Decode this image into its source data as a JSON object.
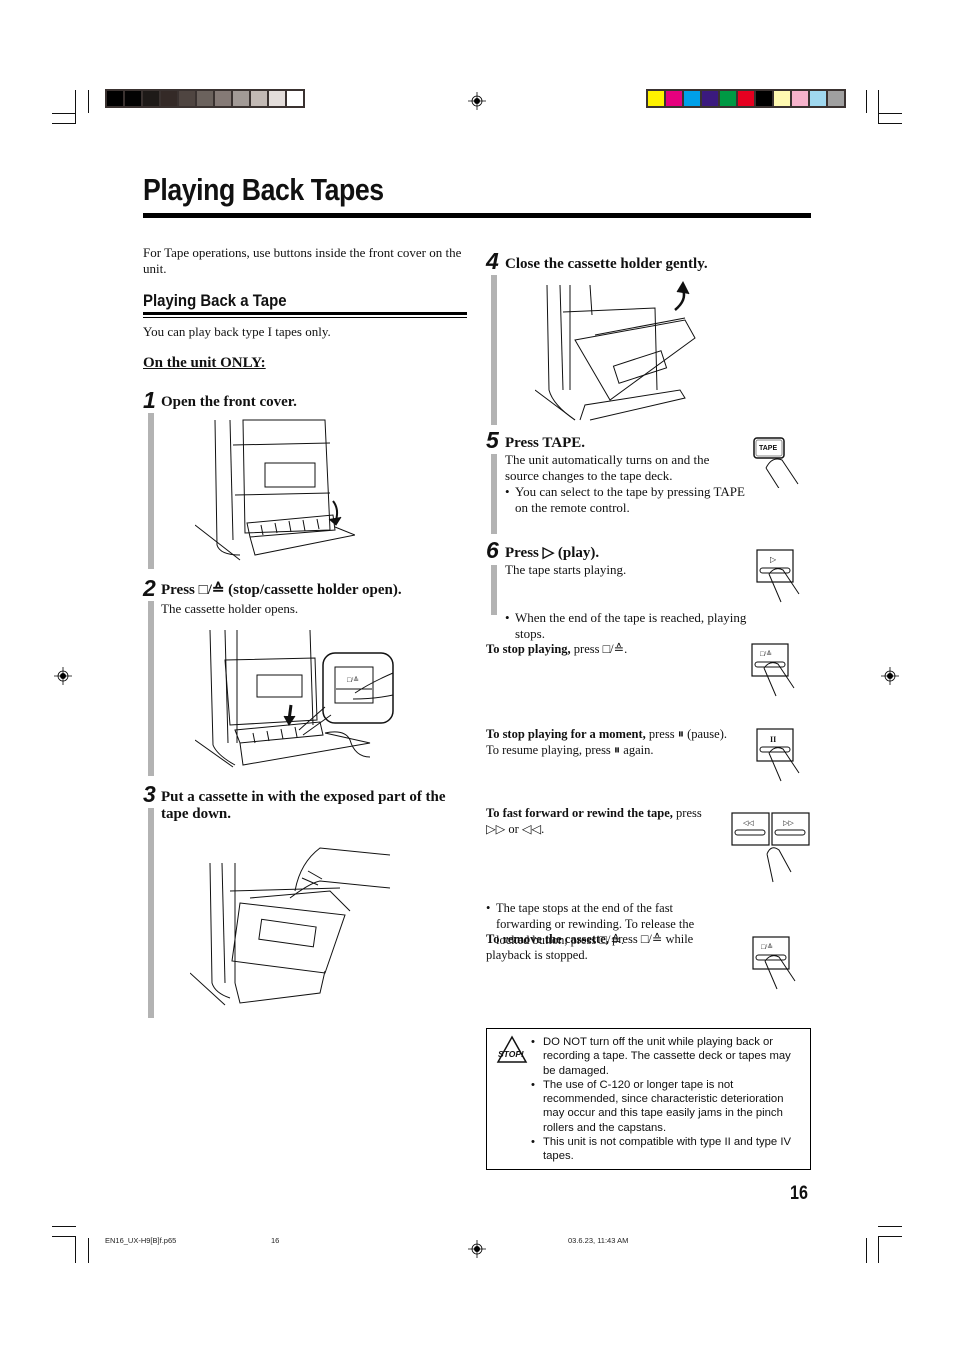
{
  "print_marks": {
    "grayscale_bar": [
      "#000000",
      "#030303",
      "#1e1a18",
      "#342a27",
      "#4f4541",
      "#6b625d",
      "#857a76",
      "#a29a96",
      "#c2b9b4",
      "#e3ddda",
      "#ffffff"
    ],
    "color_bar": [
      "#fff200",
      "#e6007e",
      "#00a0e9",
      "#3b1a7e",
      "#009944",
      "#e60020",
      "#000000",
      "#fff9b1",
      "#f6b3cb",
      "#a0d8ef",
      "#a0a0a0"
    ]
  },
  "header": {
    "title": "Playing Back Tapes"
  },
  "intro": "For Tape operations, use buttons inside the front cover on the unit.",
  "section": {
    "heading": "Playing Back a Tape",
    "note": "You can play back type I tapes only.",
    "subheading": "On the unit ONLY:"
  },
  "steps": [
    {
      "number": "1",
      "heading": "Open the front cover.",
      "body": "",
      "bullets": []
    },
    {
      "number": "2",
      "heading": "Press □/≙ (stop/cassette holder open).",
      "body": "The cassette holder opens.",
      "bullets": []
    },
    {
      "number": "3",
      "heading": "Put a cassette in with the exposed part of the tape down.",
      "body": "",
      "bullets": []
    },
    {
      "number": "4",
      "heading": "Close the cassette holder gently.",
      "body": "",
      "bullets": []
    },
    {
      "number": "5",
      "heading": "Press TAPE.",
      "body": "The unit automatically turns on and the source changes to the tape deck.",
      "bullets": [
        "You can select to the tape by pressing TAPE on the remote control."
      ]
    },
    {
      "number": "6",
      "heading": "Press ▷ (play).",
      "body": "The tape starts playing.",
      "bullets": [
        "When the end of the tape is reached, playing stops."
      ]
    }
  ],
  "operations": [
    {
      "lead": "To stop playing,",
      "text": " press □/≙.",
      "extra": "",
      "bullets": []
    },
    {
      "lead": "To stop playing for a moment,",
      "text": " press ⏸ (pause).",
      "extra": "To resume playing, press ⏸ again.",
      "bullets": []
    },
    {
      "lead": "To fast forward or rewind the tape,",
      "text": " press ▷▷ or ◁◁.",
      "extra": "",
      "bullets": [
        "The tape stops at the end of the fast forwarding or rewinding. To release the locked button, press □/≙."
      ]
    },
    {
      "lead": "To remove the cassette,",
      "text": " press □/≙ while playback is stopped.",
      "extra": "",
      "bullets": []
    }
  ],
  "button_labels": {
    "tape": "TAPE",
    "play": "▷",
    "stop_eject": "□/≙",
    "pause": "II",
    "rewind": "◁◁",
    "fast_forward": "▷▷"
  },
  "warning": {
    "icon_label": "STOP!",
    "items": [
      "DO NOT turn off the unit while playing back or recording a tape. The cassette deck or tapes may be damaged.",
      "The use of C-120 or longer tape is not recommended, since characteristic deterioration may occur and this tape easily jams in the pinch rollers and the capstans.",
      "This unit is not compatible with type II and type IV tapes."
    ]
  },
  "page_number": "16",
  "footer": {
    "filename": "EN16_UX-H9[B]f.p65",
    "page": "16",
    "timestamp": "03.6.23, 11:43 AM"
  }
}
